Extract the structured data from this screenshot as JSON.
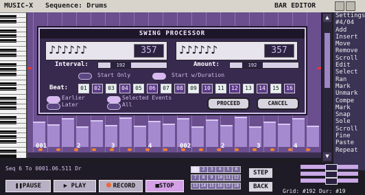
{
  "titlebar": {
    "app": "MUSIC-X",
    "sequence": "Sequence: Drums",
    "editor": "BAR EDITOR"
  },
  "dialog": {
    "title": "SWING PROCESSOR",
    "interval": {
      "notes": "♪♪♪♪♪♪",
      "value": "357",
      "label": "Interval:",
      "slider": "192"
    },
    "amount": {
      "notes": "♪♪♪♪♪♪",
      "value": "357",
      "label": "Amount:",
      "slider": "192"
    },
    "option_start_only": "Start Only",
    "option_start_duration": "Start w/Duration",
    "beat_label": "Beat:",
    "beats": [
      {
        "n": "01",
        "on": true
      },
      {
        "n": "02",
        "on": false
      },
      {
        "n": "03",
        "on": true
      },
      {
        "n": "04",
        "on": false
      },
      {
        "n": "05",
        "on": true
      },
      {
        "n": "06",
        "on": false
      },
      {
        "n": "07",
        "on": true
      },
      {
        "n": "08",
        "on": false
      },
      {
        "n": "09",
        "on": true
      },
      {
        "n": "10",
        "on": false
      },
      {
        "n": "11",
        "on": true
      },
      {
        "n": "12",
        "on": false
      },
      {
        "n": "13",
        "on": true
      },
      {
        "n": "14",
        "on": false
      },
      {
        "n": "15",
        "on": true
      },
      {
        "n": "16",
        "on": false
      }
    ],
    "opt_earlier": "Earlier",
    "opt_later": "Later",
    "opt_selected": "Selected Events",
    "opt_all": "All",
    "proceed": "PROCEED",
    "cancel": "CANCEL"
  },
  "markers": [
    "001",
    "2",
    "3",
    "4",
    "002",
    "2",
    "3",
    "4"
  ],
  "sidebar": [
    "Settings",
    "#4/04",
    "Add",
    "Insert",
    "Move",
    "Remove",
    "Scroll",
    "Edit",
    "Select",
    "Ran",
    "Mark",
    "Unmark",
    "Compe",
    "Mark",
    "Snap",
    "Sole",
    "Scroll",
    "Fine",
    "Paste",
    "Repeat"
  ],
  "counter": {
    "seq": "Seq",
    "pos": "6 To",
    "time": "0001.06.511",
    "end": "Dr"
  },
  "transport": {
    "pause": "PAUSE",
    "play": "PLAY",
    "record": "RECORD",
    "stop": "STOP"
  },
  "quantize": [
    "1",
    "2",
    "3",
    "4",
    "5",
    "6",
    "7",
    "8",
    "9",
    "10",
    "11",
    "12",
    "13",
    "14",
    "15",
    "16",
    "17",
    "18"
  ],
  "nav": {
    "step": "STEP",
    "back": "BACK"
  },
  "status": {
    "grid": "Grid: #192",
    "dur": "Dur: #19"
  },
  "bars": [
    0.7,
    0.62,
    0.8,
    0.55,
    0.74,
    0.6,
    0.82,
    0.58,
    0.72,
    0.64,
    0.8,
    0.57,
    0.75,
    0.6,
    0.83,
    0.56,
    0.7,
    0.63,
    0.79,
    0.58
  ]
}
